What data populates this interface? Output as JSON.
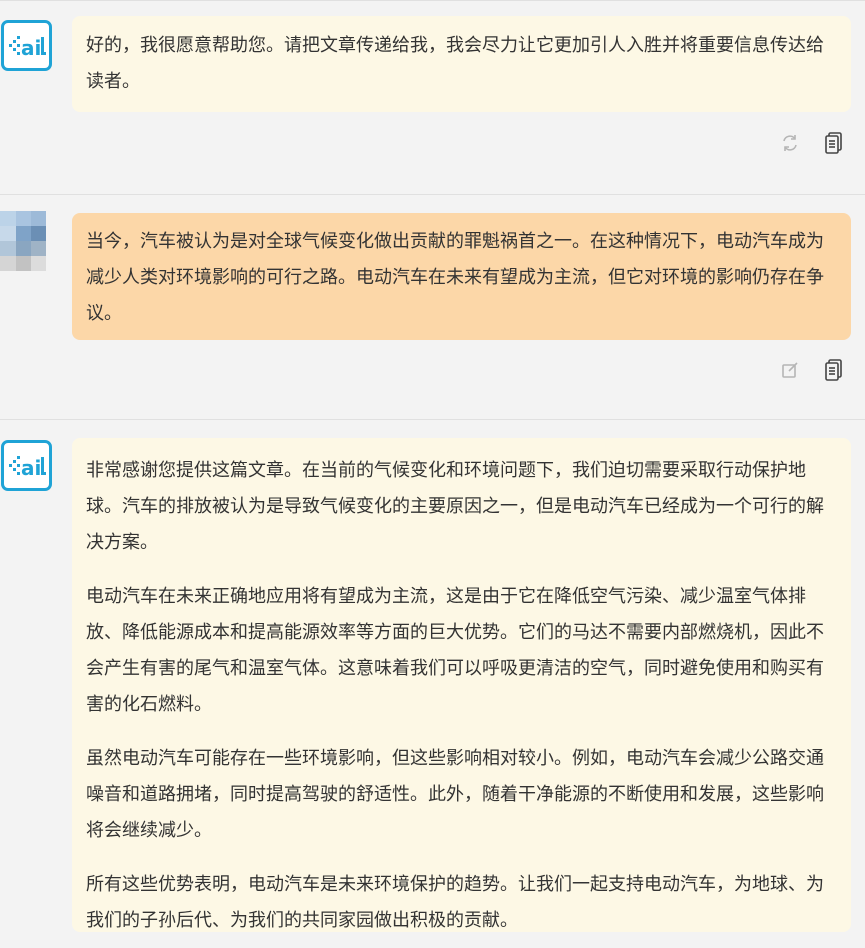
{
  "conversation": {
    "messages": [
      {
        "role": "assistant",
        "avatar_icon": "ai-logo-icon",
        "paragraphs": [
          "好的，我很愿意帮助您。请把文章传递给我，我会尽力让它更加引人入胜并将重要信息传达给读者。"
        ],
        "actions": [
          "refresh-icon",
          "copy-icon"
        ]
      },
      {
        "role": "user",
        "avatar_icon": "user-avatar",
        "paragraphs": [
          "当今，汽车被认为是对全球气候变化做出贡献的罪魁祸首之一。在这种情况下，电动汽车成为减少人类对环境影响的可行之路。电动汽车在未来有望成为主流，但它对环境的影响仍存在争议。"
        ],
        "actions": [
          "edit-icon",
          "copy-icon"
        ]
      },
      {
        "role": "assistant",
        "avatar_icon": "ai-logo-icon",
        "paragraphs": [
          "非常感谢您提供这篇文章。在当前的气候变化和环境问题下，我们迫切需要采取行动保护地球。汽车的排放被认为是导致气候变化的主要原因之一，但是电动汽车已经成为一个可行的解决方案。",
          "电动汽车在未来正确地应用将有望成为主流，这是由于它在降低空气污染、减少温室气体排放、降低能源成本和提高能源效率等方面的巨大优势。它们的马达不需要内部燃烧机，因此不会产生有害的尾气和温室气体。这意味着我们可以呼吸更清洁的空气，同时避免使用和购买有害的化石燃料。",
          "虽然电动汽车可能存在一些环境影响，但这些影响相对较小。例如，电动汽车会减少公路交通噪音和道路拥堵，同时提高驾驶的舒适性。此外，随着干净能源的不断使用和发展，这些影响将会继续减少。",
          "所有这些优势表明，电动汽车是未来环境保护的趋势。让我们一起支持电动汽车，为地球、为我们的子孙后代、为我们的共同家园做出积极的贡献。"
        ]
      }
    ]
  },
  "colors": {
    "ai_bubble": "#fdf8e5",
    "user_bubble": "#fcd7a8",
    "avatar_border": "#1fa3d6",
    "background": "#f3f3f3"
  }
}
